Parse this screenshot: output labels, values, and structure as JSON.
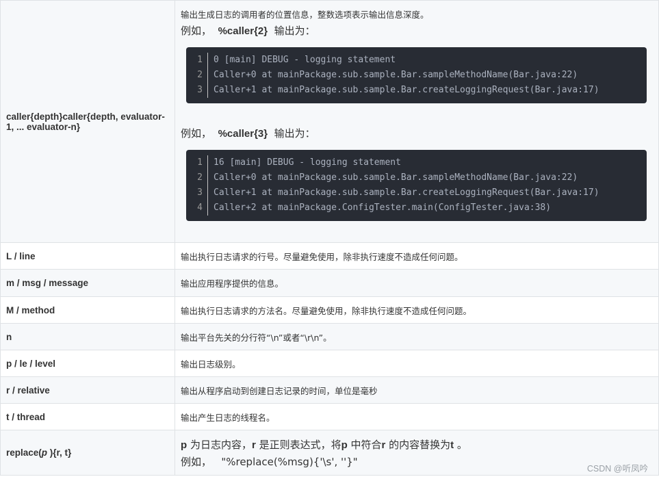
{
  "caller": {
    "key": "caller{depth}caller{depth, evaluator-1, ... evaluator-n}",
    "description": "输出生成日志的调用者的位置信息，整数选项表示输出信息深度。",
    "example1": {
      "prefix": "例如，",
      "code": "%caller{2}",
      "suffix": "输出为："
    },
    "code1": [
      {
        "n": "1",
        "text": "0 [main] DEBUG - logging statement"
      },
      {
        "n": "2",
        "text": "Caller+0 at mainPackage.sub.sample.Bar.sampleMethodName(Bar.java:22)"
      },
      {
        "n": "3",
        "text": "Caller+1 at mainPackage.sub.sample.Bar.createLoggingRequest(Bar.java:17)"
      }
    ],
    "example2": {
      "prefix": "例如，",
      "code": "%caller{3}",
      "suffix": "输出为："
    },
    "code2": [
      {
        "n": "1",
        "text": "16 [main] DEBUG - logging statement"
      },
      {
        "n": "2",
        "text": "Caller+0 at mainPackage.sub.sample.Bar.sampleMethodName(Bar.java:22)"
      },
      {
        "n": "3",
        "text": "Caller+1 at mainPackage.sub.sample.Bar.createLoggingRequest(Bar.java:17)"
      },
      {
        "n": "4",
        "text": "Caller+2 at mainPackage.ConfigTester.main(ConfigTester.java:38)"
      }
    ]
  },
  "rows": [
    {
      "key": "L / line",
      "desc": "输出执行日志请求的行号。尽量避免使用，除非执行速度不造成任何问题。"
    },
    {
      "key": "m / msg / message",
      "desc": "输出应用程序提供的信息。"
    },
    {
      "key": "M / method",
      "desc": "输出执行日志请求的方法名。尽量避免使用，除非执行速度不造成任何问题。"
    },
    {
      "key": "n",
      "desc": "输出平台先关的分行符“\\n”或者“\\r\\n”。"
    },
    {
      "key": "p / le / level",
      "desc": "输出日志级别。"
    },
    {
      "key": "r / relative",
      "desc": "输出从程序启动到创建日志记录的时间，单位是毫秒"
    },
    {
      "key": "t / thread",
      "desc": "输出产生日志的线程名。"
    }
  ],
  "replace": {
    "key_prefix": "replace(",
    "key_italic": "p",
    "key_suffix": " ){r, t}",
    "line1": [
      {
        "t": "p",
        "b": true
      },
      {
        "t": " 为日志内容，",
        "b": false
      },
      {
        "t": "r",
        "b": true
      },
      {
        "t": " 是正则表达式，将",
        "b": false
      },
      {
        "t": "p",
        "b": true
      },
      {
        "t": " 中符合",
        "b": false
      },
      {
        "t": "r",
        "b": true
      },
      {
        "t": " 的内容替换为",
        "b": false
      },
      {
        "t": "t",
        "b": true
      },
      {
        "t": " 。",
        "b": false
      }
    ],
    "line2_prefix": "例如，",
    "line2_code": "\"%replace(%msg){'\\s', ''}\""
  },
  "watermark": "CSDN @听凤吟"
}
